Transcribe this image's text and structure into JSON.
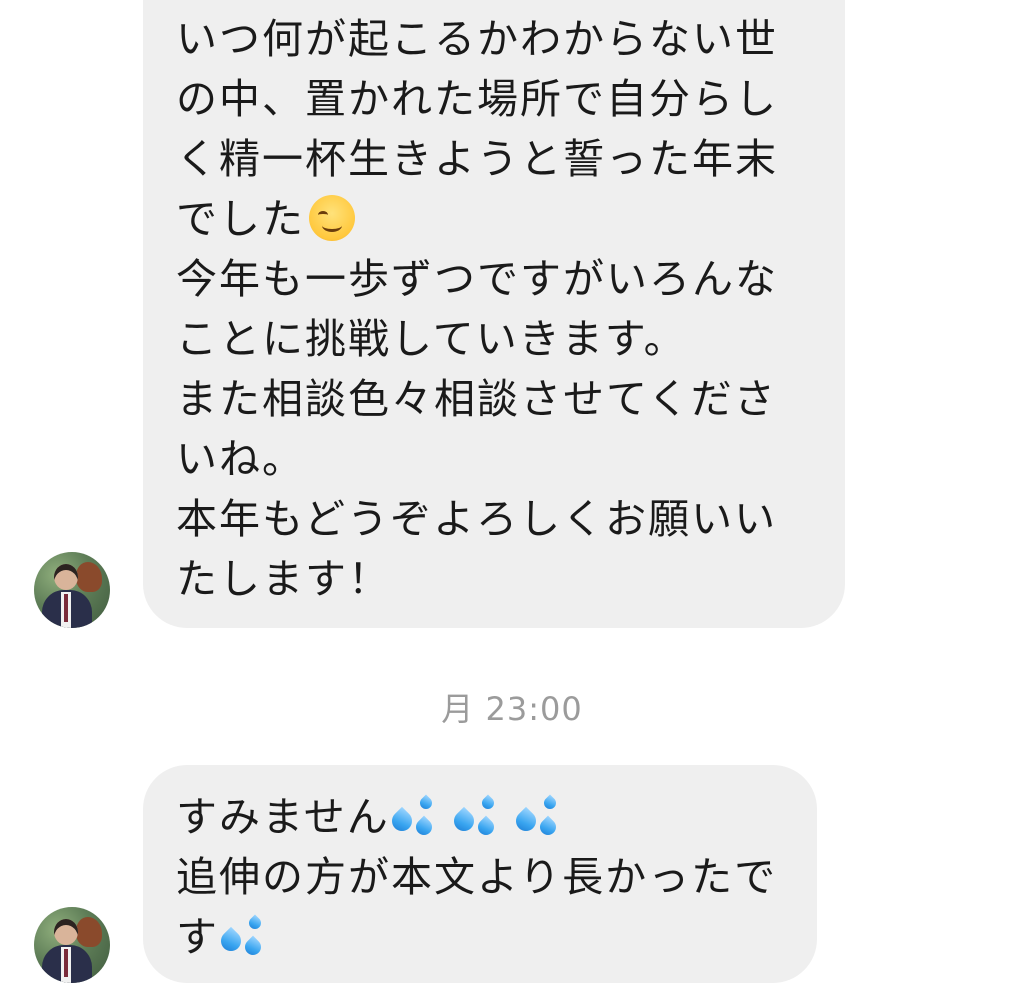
{
  "messages": [
    {
      "lines": [
        "いつ何が起こるかわからない世",
        "の中、置かれた場所で自分らし",
        "く精一杯生きようと誓った年末",
        "でした",
        "今年も一歩ずつですがいろんな",
        "ことに挑戦していきます。",
        "また相談色々相談させてくださ",
        "いね。",
        "本年もどうぞよろしくお願いい",
        "たします！"
      ],
      "emoji": [
        "smiling-face-icon"
      ]
    },
    {
      "lines": [
        "すみません",
        "追伸の方が本文より長かったで",
        "す"
      ],
      "emoji": [
        "sweat-droplets-icon"
      ]
    }
  ],
  "timestamp": "月 23:00",
  "colors": {
    "bubble_background": "#efefef",
    "timestamp_text": "#9b9b9b",
    "message_text": "#1a1a1a"
  }
}
